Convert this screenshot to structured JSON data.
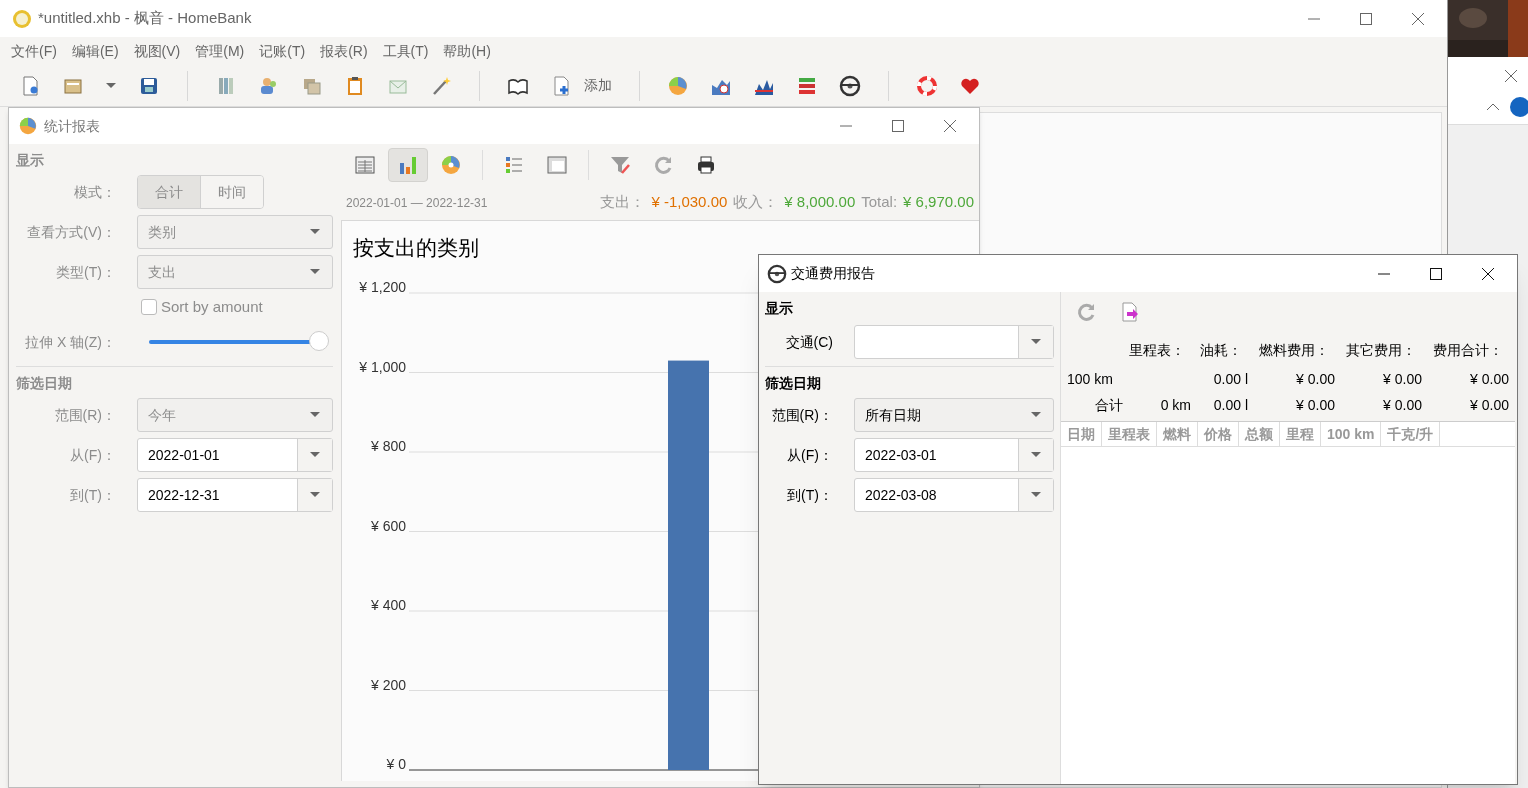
{
  "main_window": {
    "title": "*untitled.xhb - 枫音 - HomeBank",
    "menu": [
      "文件(F)",
      "编辑(E)",
      "视图(V)",
      "管理(M)",
      "记账(T)",
      "报表(R)",
      "工具(T)",
      "帮助(H)"
    ],
    "add_label": "添加"
  },
  "stats_window": {
    "title": "统计报表",
    "display_section": "显示",
    "mode_label": "模式：",
    "mode_options": [
      {
        "label": "合计",
        "selected": true
      },
      {
        "label": "时间",
        "selected": false
      }
    ],
    "view_label": "查看方式(V)：",
    "view_value": "类别",
    "type_label": "类型(T)：",
    "type_value": "支出",
    "sort": {
      "label": "Sort by amount",
      "checked": false
    },
    "zoom_label": "拉伸 X 轴(Z)：",
    "zoom": {
      "level": 1
    },
    "filter_section": "筛选日期",
    "range_label": "范围(R)：",
    "range_value": "今年",
    "from_label": "从(F)：",
    "from_value": "2022-01-01",
    "to_label": "到(T)：",
    "to_value": "2022-12-31",
    "view_buttons": [
      {
        "kind": "list",
        "selected": false
      },
      {
        "kind": "bar",
        "selected": true
      },
      {
        "kind": "pie",
        "selected": false
      }
    ],
    "date_range": "2022-01-01 — 2022-12-31",
    "expense_label": "支出：",
    "expense": "¥ -1,030.00",
    "income_label": "收入：",
    "income": "¥ 8,000.00",
    "total_label": "Total:",
    "total": "¥ 6,970.00",
    "chart_data": {
      "type": "bar",
      "title": "按支出的类别",
      "grid": true,
      "values": [
        1030
      ],
      "ylim": [
        0,
        1200
      ],
      "yticks": [
        {
          "value": 0,
          "label": "¥ 0"
        },
        {
          "value": 200,
          "label": "¥ 200"
        },
        {
          "value": 400,
          "label": "¥ 400"
        },
        {
          "value": 600,
          "label": "¥ 600"
        },
        {
          "value": 800,
          "label": "¥ 800"
        },
        {
          "value": 1000,
          "label": "¥ 1,000"
        },
        {
          "value": 1200,
          "label": "¥ 1,200"
        }
      ]
    }
  },
  "vehicle_window": {
    "title": "交通费用报告",
    "display_section": "显示",
    "vehicle_label": "交通(C)",
    "filter_section": "筛选日期",
    "range_label": "范围(R)：",
    "range_value": "所有日期",
    "from_label": "从(F)：",
    "from_value": "2022-03-01",
    "to_label": "到(T)：",
    "to_value": "2022-03-08",
    "summary_headers": [
      "里程表：",
      "油耗：",
      "燃料费用：",
      "其它费用：",
      "费用合计："
    ],
    "summary_rows": [
      {
        "label": "100 km",
        "consumption": "0.00 l",
        "fuel": "¥ 0.00",
        "other": "¥ 0.00",
        "total": "¥ 0.00"
      },
      {
        "label": "合计",
        "odometer": "0 km",
        "consumption": "0.00 l",
        "fuel": "¥ 0.00",
        "other": "¥ 0.00",
        "total": "¥ 0.00"
      }
    ],
    "columns": [
      "日期",
      "里程表",
      "燃料",
      "价格",
      "总额",
      "里程",
      "100 km",
      "千克/升"
    ]
  }
}
